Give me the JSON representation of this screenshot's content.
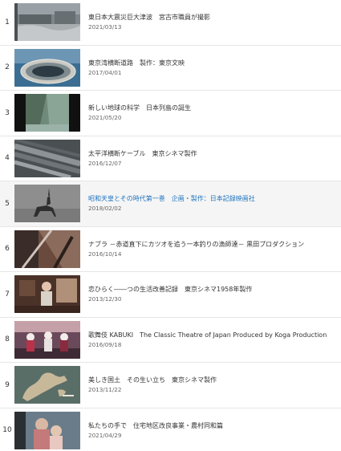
{
  "playlist": {
    "items": [
      {
        "index": "1",
        "title": "東日本大震災巨大津波　宮古市職員が撮影",
        "date": "2021/03/13",
        "thumb_icon": "tsunami-thumbnail"
      },
      {
        "index": "2",
        "title": "東京湾横断道路　製作：東京文映",
        "date": "2017/04/01",
        "thumb_icon": "tunnel-shaft-thumbnail"
      },
      {
        "index": "3",
        "title": "新しい地球の科学　日本列島の誕生",
        "date": "2021/05/20",
        "thumb_icon": "coastal-cliff-thumbnail"
      },
      {
        "index": "4",
        "title": "太平洋横断ケーブル　東京シネマ製作",
        "date": "2016/12/07",
        "thumb_icon": "cable-thumbnail"
      },
      {
        "index": "5",
        "title": "昭和天皇とその時代第一巻　企画・製作：日本記録映画社",
        "date": "2018/02/02",
        "thumb_icon": "horse-rider-thumbnail"
      },
      {
        "index": "6",
        "title": "ナブラ －赤道直下にカツオを追う一本釣りの漁師達－ 黒田プロダクション",
        "date": "2016/10/14",
        "thumb_icon": "fishing-thumbnail"
      },
      {
        "index": "7",
        "title": "恋ひらく――つの生活改善記録　東京シネマ1958年製作",
        "date": "2013/12/30",
        "thumb_icon": "kitchen-thumbnail"
      },
      {
        "index": "8",
        "title": "歌舞伎 KABUKI　The Classic Theatre of Japan Produced by Koga Production",
        "date": "2016/09/18",
        "thumb_icon": "kabuki-thumbnail"
      },
      {
        "index": "9",
        "title": "美しき国土　その生い立ち　東京シネマ製作",
        "date": "2013/11/22",
        "thumb_icon": "map-thumbnail"
      },
      {
        "index": "10",
        "title": "私たちの手で　住宅地区改良事業・農村同和篇",
        "date": "2021/04/29",
        "thumb_icon": "mother-child-thumbnail"
      }
    ],
    "active_index": "5"
  },
  "colors": {
    "active_title": "#1e73be",
    "active_row_bg": "#f5f5f5",
    "divider": "#e6e6e6"
  }
}
